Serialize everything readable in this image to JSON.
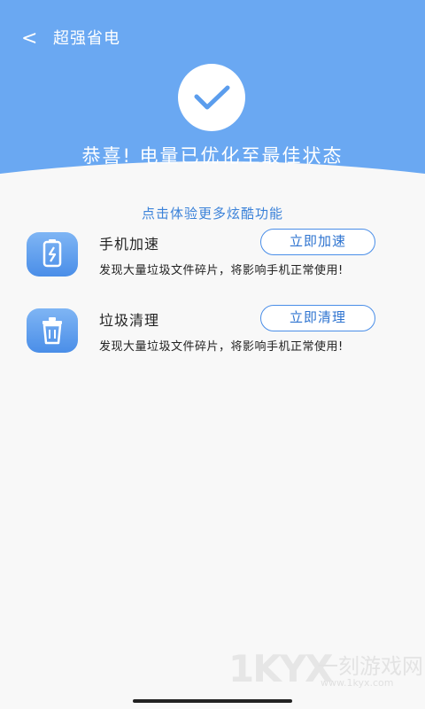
{
  "header": {
    "back_label": "<",
    "title": "超强省电"
  },
  "hero": {
    "icon": "check-icon",
    "message": "恭喜! 电量已优化至最佳状态"
  },
  "promo_link": "点击体验更多炫酷功能",
  "features": [
    {
      "icon": "phone-boost-icon",
      "title": "手机加速",
      "description": "发现大量垃圾文件碎片，将影响手机正常使用!",
      "button": "立即加速"
    },
    {
      "icon": "trash-icon",
      "title": "垃圾清理",
      "description": "发现大量垃圾文件碎片，将影响手机正常使用!",
      "button": "立即清理"
    }
  ],
  "watermark": {
    "logo": "1KYX",
    "text": "一刻游戏网",
    "url": "www.1kyx.com"
  },
  "colors": {
    "accent": "#6aa8f2",
    "button_border": "#4a8ee8",
    "promo_text": "#3b82d9"
  }
}
